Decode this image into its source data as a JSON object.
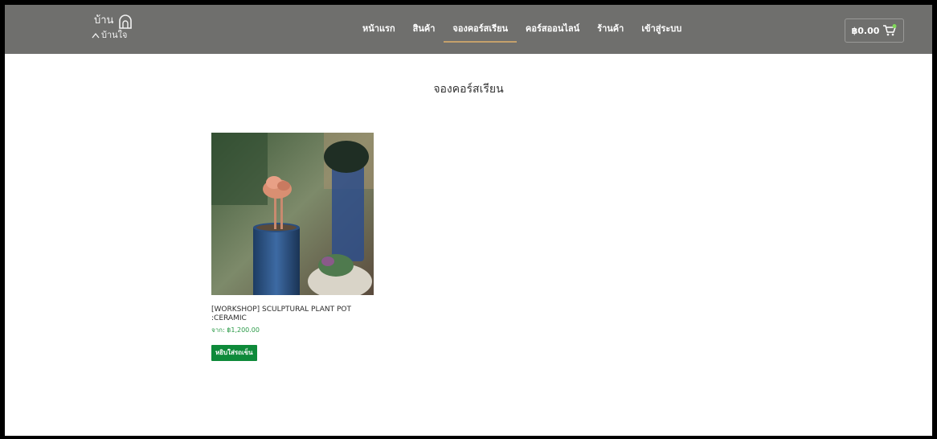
{
  "header": {
    "logo": {
      "line1": "บ้าน",
      "line2": "บ้านใจ"
    },
    "nav": [
      {
        "label": "หน้าแรก",
        "active": false
      },
      {
        "label": "สินค้า",
        "active": false
      },
      {
        "label": "จองคอร์สเรียน",
        "active": true
      },
      {
        "label": "คอร์สออนไลน์",
        "active": false
      },
      {
        "label": "ร้านค้า",
        "active": false
      },
      {
        "label": "เข้าสู่ระบบ",
        "active": false
      }
    ],
    "cart": {
      "total": "฿0.00",
      "icon": "cart-icon"
    }
  },
  "main": {
    "title": "จองคอร์สเรียน",
    "products": [
      {
        "name": "[WORKSHOP] SCULPTURAL PLANT POT :CERAMIC",
        "price": "จาก: ฿1,200.00",
        "button": "หยิบใส่รถเข็น"
      }
    ]
  },
  "colors": {
    "header_bg": "#6f6f6d",
    "active_underline": "#c4a06b",
    "price": "#2a9a47",
    "button": "#0e8a3a"
  }
}
